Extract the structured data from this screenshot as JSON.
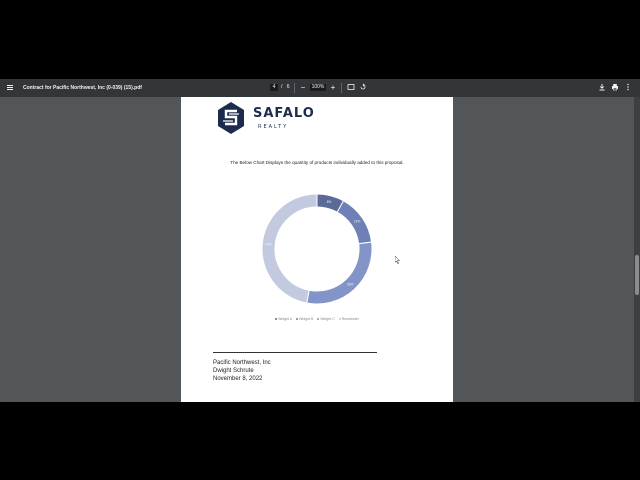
{
  "toolbar": {
    "title": "Contract for Pacific Northwest, Inc (0-039) (15).pdf",
    "page_current": "4",
    "page_separator": "/",
    "page_total": "6",
    "zoom": "100%",
    "zoom_out": "−",
    "zoom_in": "+"
  },
  "document": {
    "logo_name": "SAFALO",
    "logo_sub": "REALTY",
    "intro": "The Below Chart Displays the quantity of products individually added to this proposal.",
    "signature": {
      "company": "Pacific Northwest, Inc",
      "name": "Dwight Schrute",
      "date": "November 8, 2022"
    }
  },
  "chart_data": {
    "type": "pie",
    "style": "donut",
    "title": "",
    "series": [
      {
        "name": "Widget A",
        "value": 8,
        "label": "8%",
        "color": "#5b6b97"
      },
      {
        "name": "Widget B",
        "value": 15,
        "label": "15%",
        "color": "#6e80b5"
      },
      {
        "name": "Widget C",
        "value": 30,
        "label": "30%",
        "color": "#8394c8"
      },
      {
        "name": "Remainder",
        "value": 47,
        "label": "47%",
        "color": "#c3c9de"
      }
    ],
    "legend_position": "bottom"
  }
}
